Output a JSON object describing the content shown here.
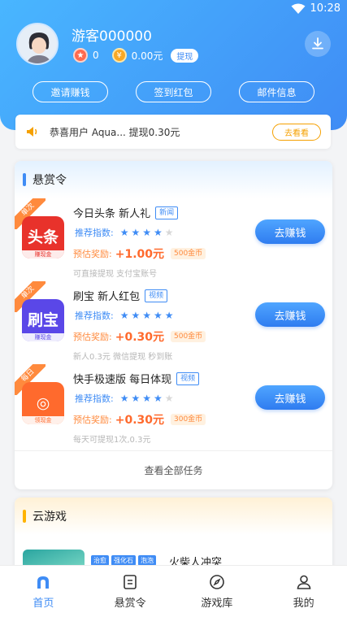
{
  "status_bar": {
    "time": "10:28"
  },
  "profile": {
    "username": "游客000000",
    "stars": "0",
    "balance": "0.00元",
    "withdraw_label": "提现"
  },
  "actions": [
    {
      "label": "邀请赚钱"
    },
    {
      "label": "签到红包"
    },
    {
      "label": "邮件信息"
    }
  ],
  "notice": {
    "text": "恭喜用户 Aqua... 提现0.30元",
    "button": "去看看"
  },
  "bounty": {
    "title": "悬赏令",
    "view_all": "查看全部任务",
    "tasks": [
      {
        "ribbon": "单次",
        "app_big": "头条",
        "app_small": "赚现金",
        "name": "今日头条 新人礼",
        "tag": "新闻",
        "rec_label": "推荐指数:",
        "stars_on": "★★★★",
        "stars_off": "★",
        "reward_label": "预估奖励:",
        "amount": "+1.00元",
        "gold": "500金币",
        "hint": "可直接提现 支付宝账号",
        "button": "去赚钱"
      },
      {
        "ribbon": "单次",
        "app_big": "刷宝",
        "app_small": "赚现金",
        "name": "刷宝 新人红包",
        "tag": "视频",
        "rec_label": "推荐指数:",
        "stars_on": "★★★★★",
        "stars_off": "",
        "reward_label": "预估奖励:",
        "amount": "+0.30元",
        "gold": "500金币",
        "hint": "新人0.3元 微信提现 秒到账",
        "button": "去赚钱"
      },
      {
        "ribbon": "每日",
        "app_big": "◎",
        "app_small": "领现金",
        "name": "快手极速版 每日体现",
        "tag": "视频",
        "rec_label": "推荐指数:",
        "stars_on": "★★★★",
        "stars_off": "★",
        "reward_label": "预估奖励:",
        "amount": "+0.30元",
        "gold": "300金币",
        "hint": "每天可提现1次,0.3元",
        "button": "去赚钱"
      }
    ]
  },
  "games": {
    "title": "云游戏",
    "items": [
      {
        "name": "火柴人冲突",
        "tags": [
          "治愈",
          "强化石",
          "泡泡"
        ]
      }
    ]
  },
  "tabbar": [
    {
      "label": "首页",
      "icon": "home-icon",
      "active": true
    },
    {
      "label": "悬赏令",
      "icon": "task-list-icon",
      "active": false
    },
    {
      "label": "游戏库",
      "icon": "compass-icon",
      "active": false
    },
    {
      "label": "我的",
      "icon": "user-icon",
      "active": false
    }
  ],
  "colors": {
    "primary": "#3f8cf5",
    "accent": "#ff8a3d",
    "notice": "#f5a000"
  }
}
